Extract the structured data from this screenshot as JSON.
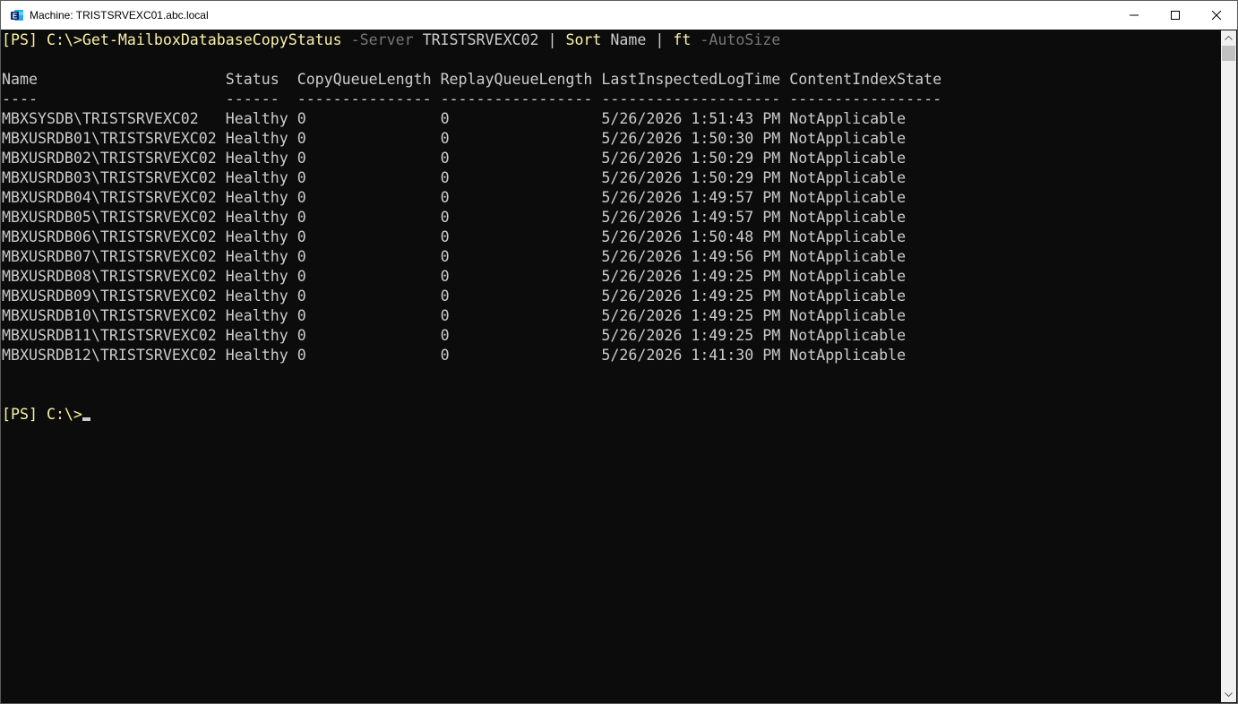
{
  "window": {
    "title": "Machine: TRISTSRVEXC01.abc.local",
    "icon": "exchange-management-shell-icon",
    "accent": "#0078d4"
  },
  "console": {
    "command": {
      "prompt": "[PS] C:\\>",
      "cmdlet": "Get-MailboxDatabaseCopyStatus",
      "param1": "-Server",
      "arg1": "TRISTSRVEXC02",
      "pipe1": "|",
      "cmd2": "Sort",
      "arg2": "Name",
      "pipe2": "|",
      "cmd3": "ft",
      "param3": "-AutoSize"
    },
    "headers": [
      "Name",
      "Status",
      "CopyQueueLength",
      "ReplayQueueLength",
      "LastInspectedLogTime",
      "ContentIndexState"
    ],
    "underlines": [
      "----",
      "------",
      "---------------",
      "-----------------",
      "--------------------",
      "-----------------"
    ],
    "rows": [
      [
        "MBXSYSDB\\TRISTSRVEXC02",
        "Healthy",
        "0",
        "0",
        "5/26/2026 1:51:43 PM",
        "NotApplicable"
      ],
      [
        "MBXUSRDB01\\TRISTSRVEXC02",
        "Healthy",
        "0",
        "0",
        "5/26/2026 1:50:30 PM",
        "NotApplicable"
      ],
      [
        "MBXUSRDB02\\TRISTSRVEXC02",
        "Healthy",
        "0",
        "0",
        "5/26/2026 1:50:29 PM",
        "NotApplicable"
      ],
      [
        "MBXUSRDB03\\TRISTSRVEXC02",
        "Healthy",
        "0",
        "0",
        "5/26/2026 1:50:29 PM",
        "NotApplicable"
      ],
      [
        "MBXUSRDB04\\TRISTSRVEXC02",
        "Healthy",
        "0",
        "0",
        "5/26/2026 1:49:57 PM",
        "NotApplicable"
      ],
      [
        "MBXUSRDB05\\TRISTSRVEXC02",
        "Healthy",
        "0",
        "0",
        "5/26/2026 1:49:57 PM",
        "NotApplicable"
      ],
      [
        "MBXUSRDB06\\TRISTSRVEXC02",
        "Healthy",
        "0",
        "0",
        "5/26/2026 1:50:48 PM",
        "NotApplicable"
      ],
      [
        "MBXUSRDB07\\TRISTSRVEXC02",
        "Healthy",
        "0",
        "0",
        "5/26/2026 1:49:56 PM",
        "NotApplicable"
      ],
      [
        "MBXUSRDB08\\TRISTSRVEXC02",
        "Healthy",
        "0",
        "0",
        "5/26/2026 1:49:25 PM",
        "NotApplicable"
      ],
      [
        "MBXUSRDB09\\TRISTSRVEXC02",
        "Healthy",
        "0",
        "0",
        "5/26/2026 1:49:25 PM",
        "NotApplicable"
      ],
      [
        "MBXUSRDB10\\TRISTSRVEXC02",
        "Healthy",
        "0",
        "0",
        "5/26/2026 1:49:25 PM",
        "NotApplicable"
      ],
      [
        "MBXUSRDB11\\TRISTSRVEXC02",
        "Healthy",
        "0",
        "0",
        "5/26/2026 1:49:25 PM",
        "NotApplicable"
      ],
      [
        "MBXUSRDB12\\TRISTSRVEXC02",
        "Healthy",
        "0",
        "0",
        "5/26/2026 1:41:30 PM",
        "NotApplicable"
      ]
    ],
    "final_prompt": "[PS] C:\\>",
    "colors": {
      "background": "#0c0c0c",
      "text": "#cccccc",
      "yellow": "#f9f1a5",
      "gray": "#767676"
    }
  }
}
